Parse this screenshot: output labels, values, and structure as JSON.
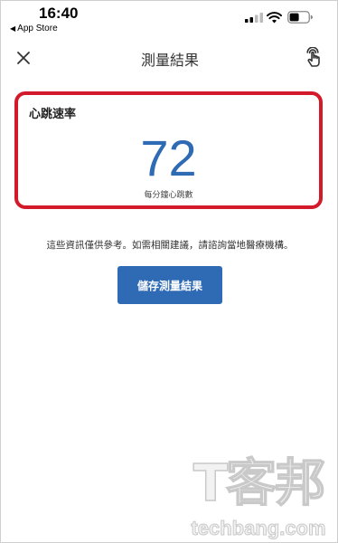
{
  "status_bar": {
    "time": "16:40",
    "back_app_label": "App Store"
  },
  "app_bar": {
    "title": "測量結果",
    "close_icon": "close-icon",
    "gesture_icon": "hand-pointer-icon"
  },
  "result_card": {
    "title": "心跳速率",
    "value": "72",
    "unit": "每分鐘心跳數",
    "highlight_color": "#d31a2a",
    "value_color": "#2f6ab5"
  },
  "disclaimer": "這些資訊僅供參考。如需相關建議，請諮詢當地醫療機構。",
  "save_button": {
    "label": "儲存測量結果",
    "color": "#2f6ab5"
  },
  "watermark": {
    "main": "T客邦",
    "sub": "techbang.com"
  }
}
